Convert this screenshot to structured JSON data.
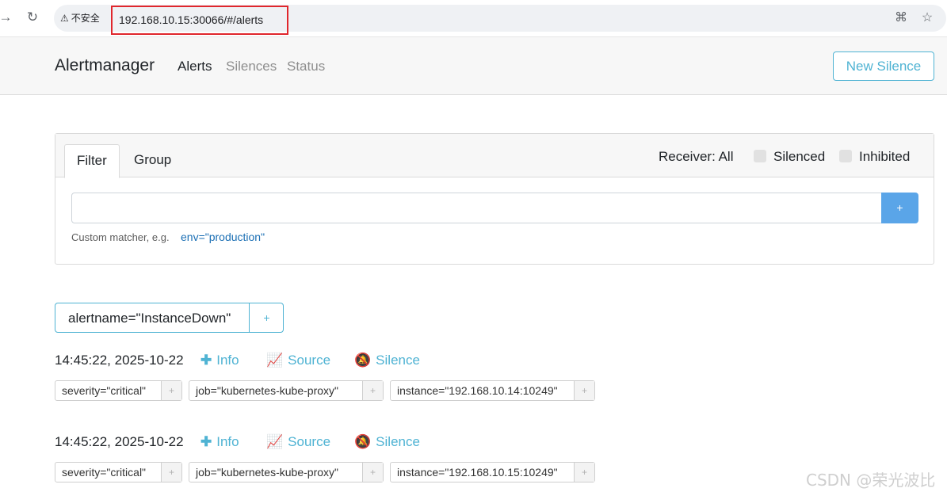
{
  "browser": {
    "security_label": "不安全",
    "url": "192.168.10.15:30066/#/alerts"
  },
  "navbar": {
    "brand": "Alertmanager",
    "links": [
      "Alerts",
      "Silences",
      "Status"
    ],
    "new_silence": "New Silence"
  },
  "filter_card": {
    "tabs": [
      "Filter",
      "Group"
    ],
    "receiver": "Receiver: All",
    "silenced_label": "Silenced",
    "inhibited_label": "Inhibited",
    "input_value": "",
    "add_button": "+",
    "hint": "Custom matcher, e.g.",
    "hint_example": "env=\"production\""
  },
  "group": {
    "label": "alertname=\"InstanceDown\"",
    "add": "+"
  },
  "alerts": [
    {
      "time": "14:45:22, 2025-10-22",
      "info": "Info",
      "source": "Source",
      "silence": "Silence",
      "labels": [
        "severity=\"critical\"",
        "job=\"kubernetes-kube-proxy\"",
        "instance=\"192.168.10.14:10249\""
      ]
    },
    {
      "time": "14:45:22, 2025-10-22",
      "info": "Info",
      "source": "Source",
      "silence": "Silence",
      "labels": [
        "severity=\"critical\"",
        "job=\"kubernetes-kube-proxy\"",
        "instance=\"192.168.10.15:10249\""
      ]
    }
  ],
  "label_add": "+",
  "watermark": "CSDN @荣光波比",
  "colors": {
    "accent": "#4fb3d3",
    "primary_button": "#5aa5e8",
    "highlight_box": "#e0262c"
  }
}
